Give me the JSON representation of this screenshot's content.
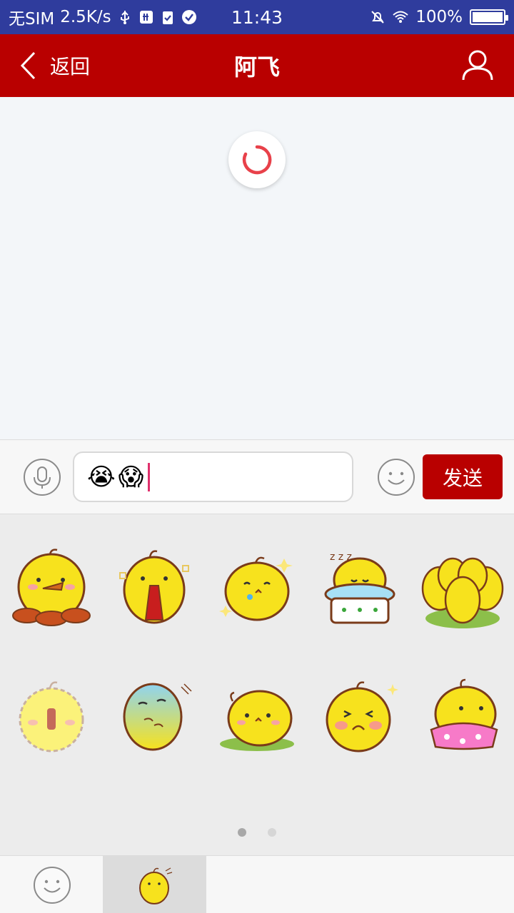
{
  "status_bar": {
    "carrier": "无SIM",
    "speed": "2.5K/s",
    "time": "11:43",
    "battery": "100%",
    "battery_level": 1.0
  },
  "header": {
    "back_label": "返回",
    "title": "阿飞",
    "icons": {
      "back": "chevron-left-icon",
      "user": "user-profile-icon"
    },
    "background": "#b90000"
  },
  "chat": {
    "loading": true,
    "spinner_color": "#e8414a"
  },
  "composer": {
    "input_emojis": [
      "😭",
      "😱"
    ],
    "send_label": "发送",
    "icons": {
      "voice": "microphone-icon",
      "emoji": "smiley-icon"
    }
  },
  "stickers": {
    "items": [
      "chick-eating-drumsticks",
      "chick-megaphone-mouth",
      "chick-crying-sparkles",
      "chick-sleeping-blanket",
      "chick-group",
      "chick-faded-shouting",
      "chick-blue-sick",
      "chick-lying-on-grass",
      "chick-blushing-sparkle",
      "chick-pink-polka-skirt"
    ],
    "pages": 2,
    "current_page": 1
  },
  "tabs": [
    {
      "icon": "smiley-icon",
      "selected": false
    },
    {
      "icon": "chick-sticker-icon",
      "selected": true
    }
  ]
}
